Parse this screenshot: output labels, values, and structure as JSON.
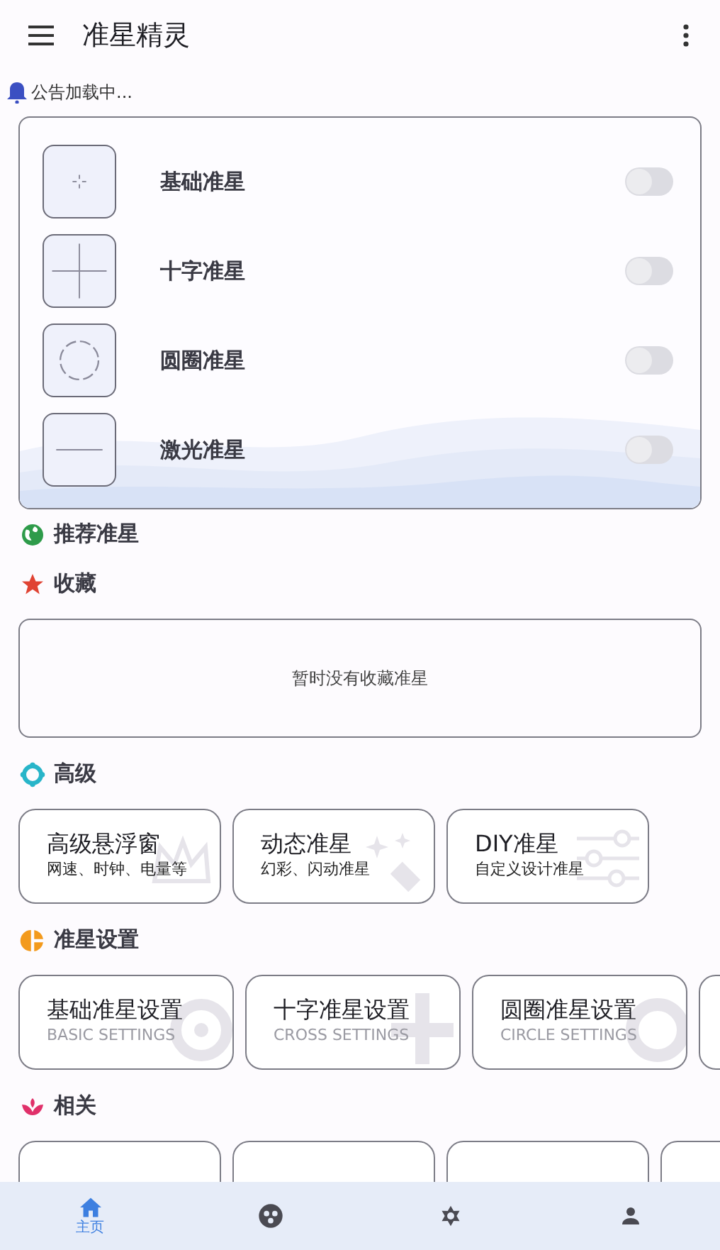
{
  "app_bar": {
    "title": "准星精灵"
  },
  "notice": {
    "text": "公告加载中..."
  },
  "crosshairs": [
    {
      "kind": "dot",
      "label": "基础准星",
      "on": false
    },
    {
      "kind": "cross",
      "label": "十字准星",
      "on": false
    },
    {
      "kind": "circle",
      "label": "圆圈准星",
      "on": false
    },
    {
      "kind": "line",
      "label": "激光准星",
      "on": false
    }
  ],
  "sections": [
    {
      "kind": "globe",
      "title": "推荐准星"
    },
    {
      "kind": "star",
      "title": "收藏",
      "empty_text": "暂时没有收藏准星"
    },
    {
      "kind": "advanced",
      "title": "高级",
      "cards": [
        {
          "kind": "crown",
          "title": "高级悬浮窗",
          "subtitle": "网速、时钟、电量等"
        },
        {
          "kind": "sparkle",
          "title": "动态准星",
          "subtitle": "幻彩、闪动准星"
        },
        {
          "kind": "sliders",
          "title": "DIY准星",
          "subtitle": "自定义设计准星"
        }
      ]
    },
    {
      "kind": "pie",
      "title": "准星设置",
      "cards": [
        {
          "kind": "dot",
          "title": "基础准星设置",
          "subtitle": "BASIC SETTINGS"
        },
        {
          "kind": "cross",
          "title": "十字准星设置",
          "subtitle": "CROSS SETTINGS"
        },
        {
          "kind": "circle",
          "title": "圆圈准星设置",
          "subtitle": "CIRCLE SETTINGS"
        }
      ]
    },
    {
      "kind": "lotus",
      "title": "相关"
    }
  ],
  "bottom_nav": [
    {
      "kind": "home",
      "label": "主页",
      "selected": true
    },
    {
      "kind": "game",
      "selected": false
    },
    {
      "kind": "settings",
      "selected": false
    },
    {
      "kind": "person",
      "selected": false
    }
  ]
}
